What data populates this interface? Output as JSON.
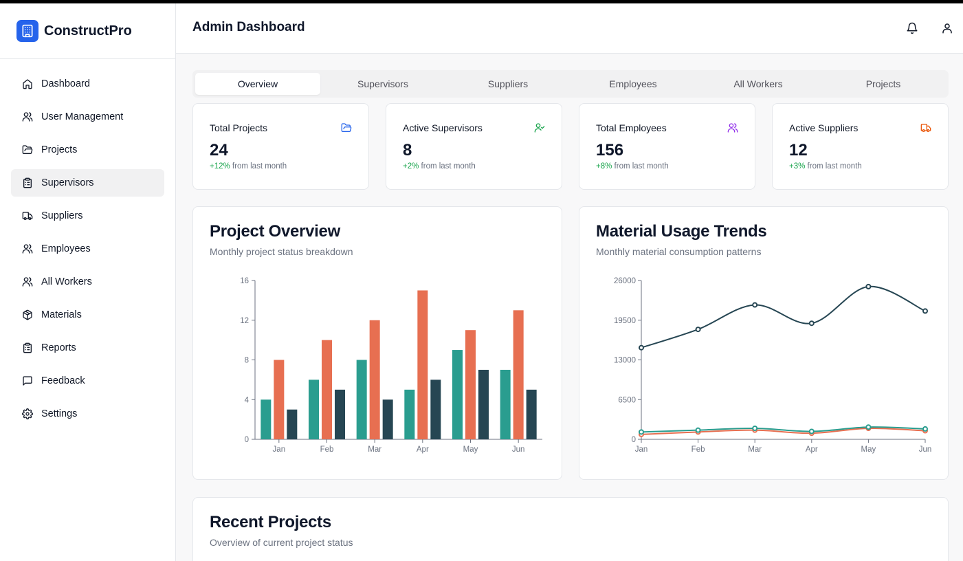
{
  "brand": {
    "name": "ConstructPro"
  },
  "sidebar": {
    "items": [
      {
        "label": "Dashboard",
        "icon": "home-icon",
        "active": false
      },
      {
        "label": "User Management",
        "icon": "users-icon",
        "active": false
      },
      {
        "label": "Projects",
        "icon": "folder-icon",
        "active": false
      },
      {
        "label": "Supervisors",
        "icon": "clipboard-icon",
        "active": true
      },
      {
        "label": "Suppliers",
        "icon": "truck-icon",
        "active": false
      },
      {
        "label": "Employees",
        "icon": "users-icon",
        "active": false
      },
      {
        "label": "All Workers",
        "icon": "users-icon",
        "active": false
      },
      {
        "label": "Materials",
        "icon": "package-icon",
        "active": false
      },
      {
        "label": "Reports",
        "icon": "clipboard-list-icon",
        "active": false
      },
      {
        "label": "Feedback",
        "icon": "message-square-icon",
        "active": false
      },
      {
        "label": "Settings",
        "icon": "gear-icon",
        "active": false
      }
    ]
  },
  "header": {
    "title": "Admin Dashboard",
    "icons": [
      "bell-icon",
      "user-icon"
    ]
  },
  "tabs": [
    {
      "label": "Overview",
      "active": true
    },
    {
      "label": "Supervisors",
      "active": false
    },
    {
      "label": "Suppliers",
      "active": false
    },
    {
      "label": "Employees",
      "active": false
    },
    {
      "label": "All Workers",
      "active": false
    },
    {
      "label": "Projects",
      "active": false
    }
  ],
  "stats": [
    {
      "label": "Total Projects",
      "value": "24",
      "change": "+12%",
      "change_suffix": " from last month",
      "icon": "folder-icon",
      "color": "#2563eb"
    },
    {
      "label": "Active Supervisors",
      "value": "8",
      "change": "+2%",
      "change_suffix": " from last month",
      "icon": "user-check-icon",
      "color": "#16a34a"
    },
    {
      "label": "Total Employees",
      "value": "156",
      "change": "+8%",
      "change_suffix": " from last month",
      "icon": "users-icon",
      "color": "#9333ea"
    },
    {
      "label": "Active Suppliers",
      "value": "12",
      "change": "+3%",
      "change_suffix": " from last month",
      "icon": "truck-icon",
      "color": "#ea580c"
    }
  ],
  "project_overview": {
    "title": "Project Overview",
    "subtitle": "Monthly project status breakdown"
  },
  "material_trends": {
    "title": "Material Usage Trends",
    "subtitle": "Monthly material consumption patterns"
  },
  "recent_projects": {
    "title": "Recent Projects",
    "subtitle": "Overview of current project status"
  },
  "chart_data": [
    {
      "type": "bar",
      "categories": [
        "Jan",
        "Feb",
        "Mar",
        "Apr",
        "May",
        "Jun"
      ],
      "ylim": [
        0,
        16
      ],
      "yticks": [
        0,
        4,
        8,
        12,
        16
      ],
      "series": [
        {
          "values": [
            4,
            6,
            8,
            5,
            9,
            7
          ],
          "color": "#2a9d8f"
        },
        {
          "values": [
            8,
            10,
            12,
            15,
            11,
            13
          ],
          "color": "#e76f51"
        },
        {
          "values": [
            3,
            5,
            4,
            6,
            7,
            5
          ],
          "color": "#264653"
        }
      ],
      "grid": false
    },
    {
      "type": "line",
      "categories": [
        "Jan",
        "Feb",
        "Mar",
        "Apr",
        "May",
        "Jun"
      ],
      "ylim": [
        0,
        26000
      ],
      "yticks": [
        0,
        6500,
        13000,
        19500,
        26000
      ],
      "series": [
        {
          "values": [
            15000,
            18000,
            22000,
            19000,
            25000,
            21000
          ],
          "color": "#264653"
        },
        {
          "values": [
            1200,
            1500,
            1800,
            1300,
            2000,
            1700
          ],
          "color": "#2a9d8f"
        },
        {
          "values": [
            800,
            1200,
            1500,
            1000,
            1800,
            1400
          ],
          "color": "#e76f51"
        }
      ],
      "grid": false
    }
  ]
}
